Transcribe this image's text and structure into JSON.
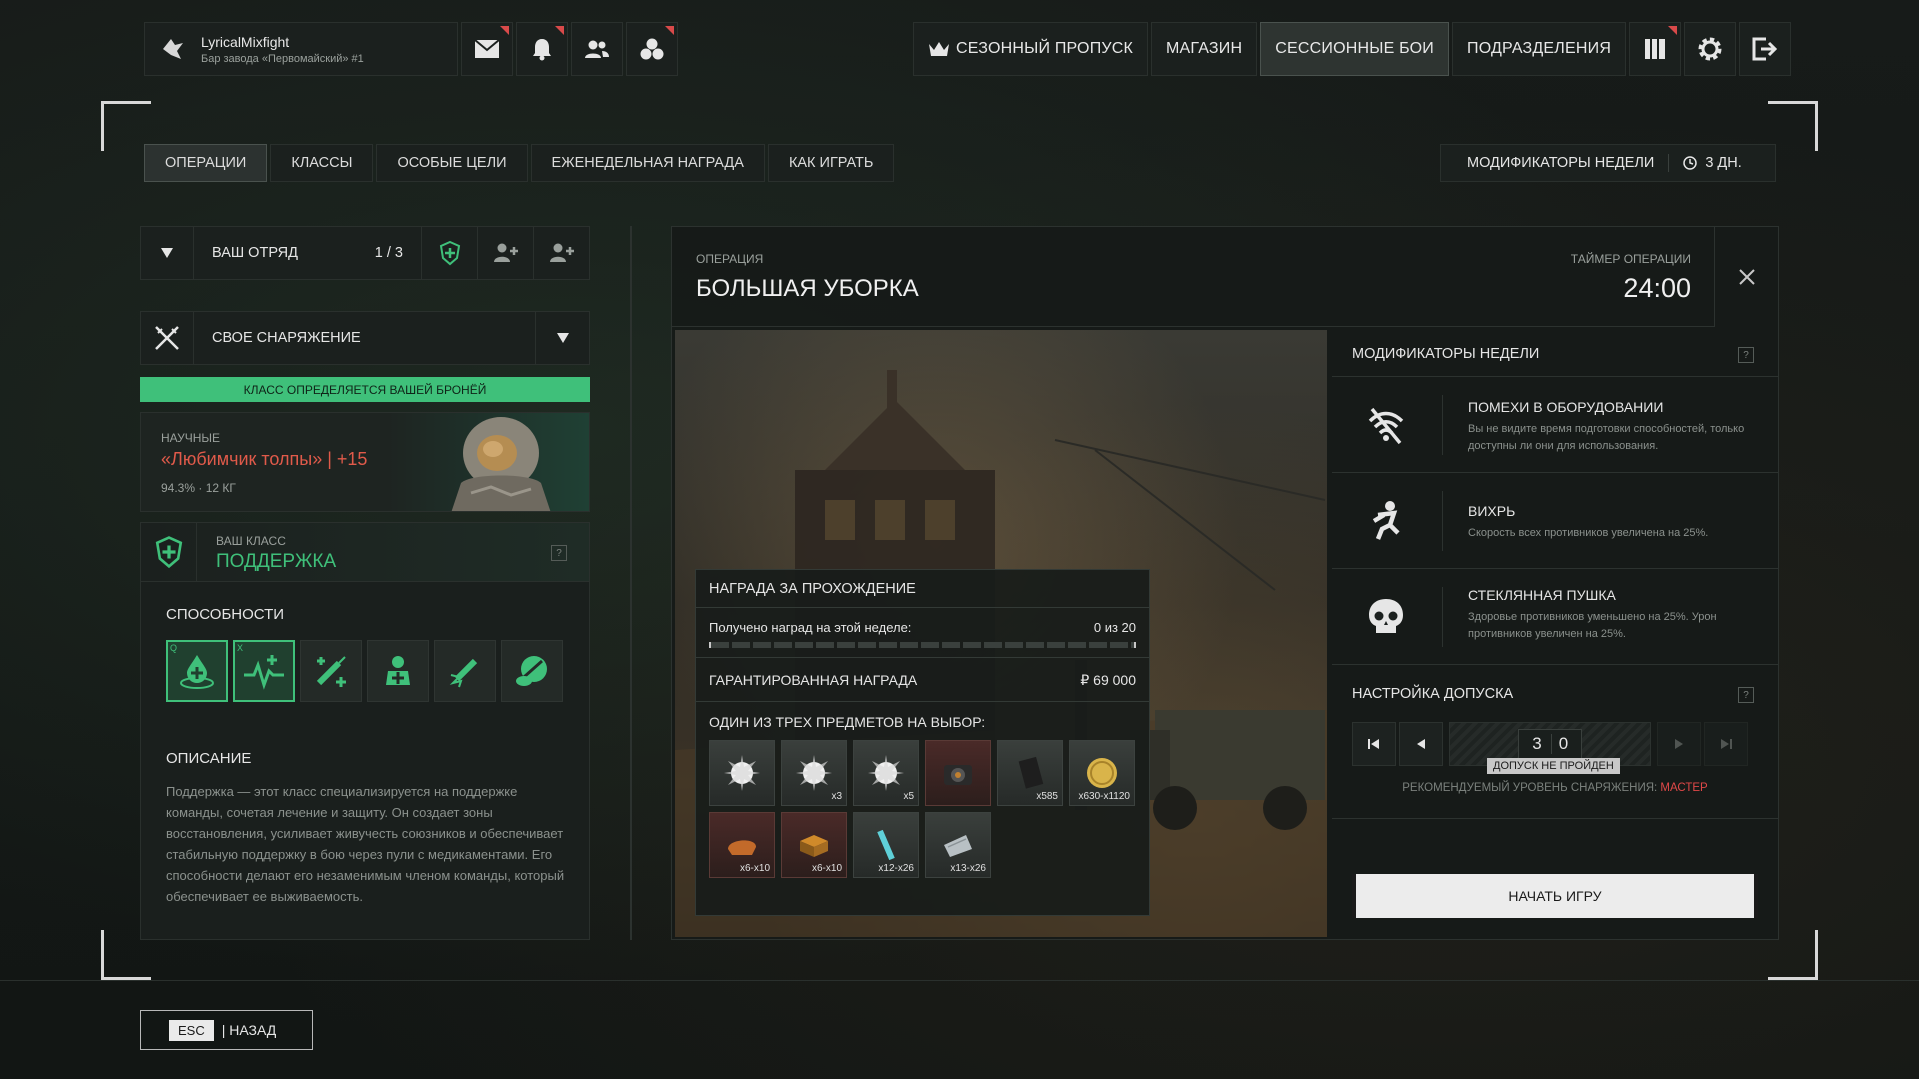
{
  "profile": {
    "name": "LyricalMixfight",
    "location": "Бар завода «Первомайский» #1"
  },
  "topnav": {
    "season_pass": "СЕЗОННЫЙ ПРОПУСК",
    "shop": "МАГАЗИН",
    "session_battles": "СЕССИОННЫЕ БОИ",
    "divisions": "ПОДРАЗДЕЛЕНИЯ"
  },
  "tabs": [
    "ОПЕРАЦИИ",
    "КЛАССЫ",
    "ОСОБЫЕ ЦЕЛИ",
    "ЕЖЕНЕДЕЛЬНАЯ НАГРАДА",
    "КАК ИГРАТЬ"
  ],
  "week_modifiers_bar": {
    "label": "МОДИФИКАТОРЫ НЕДЕЛИ",
    "time_left": "3 ДН."
  },
  "squad": {
    "label": "ВАШ ОТРЯД",
    "count": "1 / 3"
  },
  "gear": {
    "label": "СВОЕ СНАРЯЖЕНИЕ"
  },
  "class_notice": "КЛАСС ОПРЕДЕЛЯЕТСЯ ВАШЕЙ БРОНЁЙ",
  "armor": {
    "category": "НАУЧНЫЕ",
    "name": "«Любимчик толпы» | +15",
    "stats": "94.3% · 12 КГ"
  },
  "your_class": {
    "label": "ВАШ КЛАСС",
    "name": "ПОДДЕРЖКА",
    "help": "?"
  },
  "abilities": {
    "title": "СПОСОБНОСТИ",
    "badge_1": "Q",
    "badge_2": "X"
  },
  "description": {
    "title": "ОПИСАНИЕ",
    "text": "Поддержка — этот класс специализируется на поддержке команды, сочетая лечение и защиту. Он создает зоны восстановления, усиливает живучесть союзников и обеспечивает стабильную поддержку в бою через пули с медикаментами. Его способности делают его незаменимым членом команды, который обеспечивает ее выживаемость."
  },
  "operation": {
    "label": "ОПЕРАЦИЯ",
    "name": "БОЛЬШАЯ УБОРКА",
    "timer_label": "ТАЙМЕР ОПЕРАЦИИ",
    "timer": "24:00"
  },
  "reward": {
    "title": "НАГРАДА ЗА ПРОХОЖДЕНИЕ",
    "weekly_label": "Получено наград на этой неделе:",
    "weekly_value": "0 из 20",
    "weekly_progress": 0,
    "guaranteed_label": "ГАРАНТИРОВАННАЯ НАГРАДА",
    "guaranteed_value": "₽ 69 000",
    "choice_title": "ОДИН ИЗ ТРЕХ ПРЕДМЕТОВ НА ВЫБОР:",
    "items": [
      {
        "count": "",
        "icon": "flare-icon"
      },
      {
        "count": "x3",
        "icon": "flare-icon"
      },
      {
        "count": "x5",
        "icon": "flare-icon"
      },
      {
        "count": "",
        "icon": "camera-icon"
      },
      {
        "count": "x585",
        "icon": "battery-icon"
      },
      {
        "count": "x630-x1120",
        "icon": "coin-icon"
      },
      {
        "count": "x6-x10",
        "icon": "food-icon"
      },
      {
        "count": "x6-x10",
        "icon": "crate-icon"
      },
      {
        "count": "x12-x26",
        "icon": "chemlight-icon"
      },
      {
        "count": "x13-x26",
        "icon": "scrap-icon"
      }
    ]
  },
  "modifiers": {
    "title": "МОДИФИКАТОРЫ НЕДЕЛИ",
    "help": "?",
    "items": [
      {
        "name": "ПОМЕХИ В ОБОРУДОВАНИИ",
        "desc": "Вы не видите время подготовки способностей, только доступны ли они для использования.",
        "icon": "no-signal-icon"
      },
      {
        "name": "ВИХРЬ",
        "desc": "Скорость всех противников увеличена на 25%.",
        "icon": "running-figure-icon"
      },
      {
        "name": "СТЕКЛЯННАЯ ПУШКА",
        "desc": "Здоровье противников уменьшено на 25%. Урон противников увеличен на 25%.",
        "icon": "skull-icon"
      }
    ]
  },
  "clearance": {
    "title": "НАСТРОЙКА ДОПУСКА",
    "help": "?",
    "digit_1": "3",
    "digit_2": "0",
    "status": "ДОПУСК НЕ ПРОЙДЕН",
    "recommended_label": "РЕКОМЕНДУЕМЫЙ УРОВЕНЬ СНАРЯЖЕНИЯ:",
    "recommended_value": "МАСТЕР"
  },
  "start_button": "НАЧАТЬ ИГРУ",
  "back": {
    "key": "ESC",
    "label": "| НАЗАД"
  },
  "colors": {
    "accent_green": "#3fc07a",
    "warning_red": "#e04848",
    "armor_name": "#e05a4a"
  }
}
